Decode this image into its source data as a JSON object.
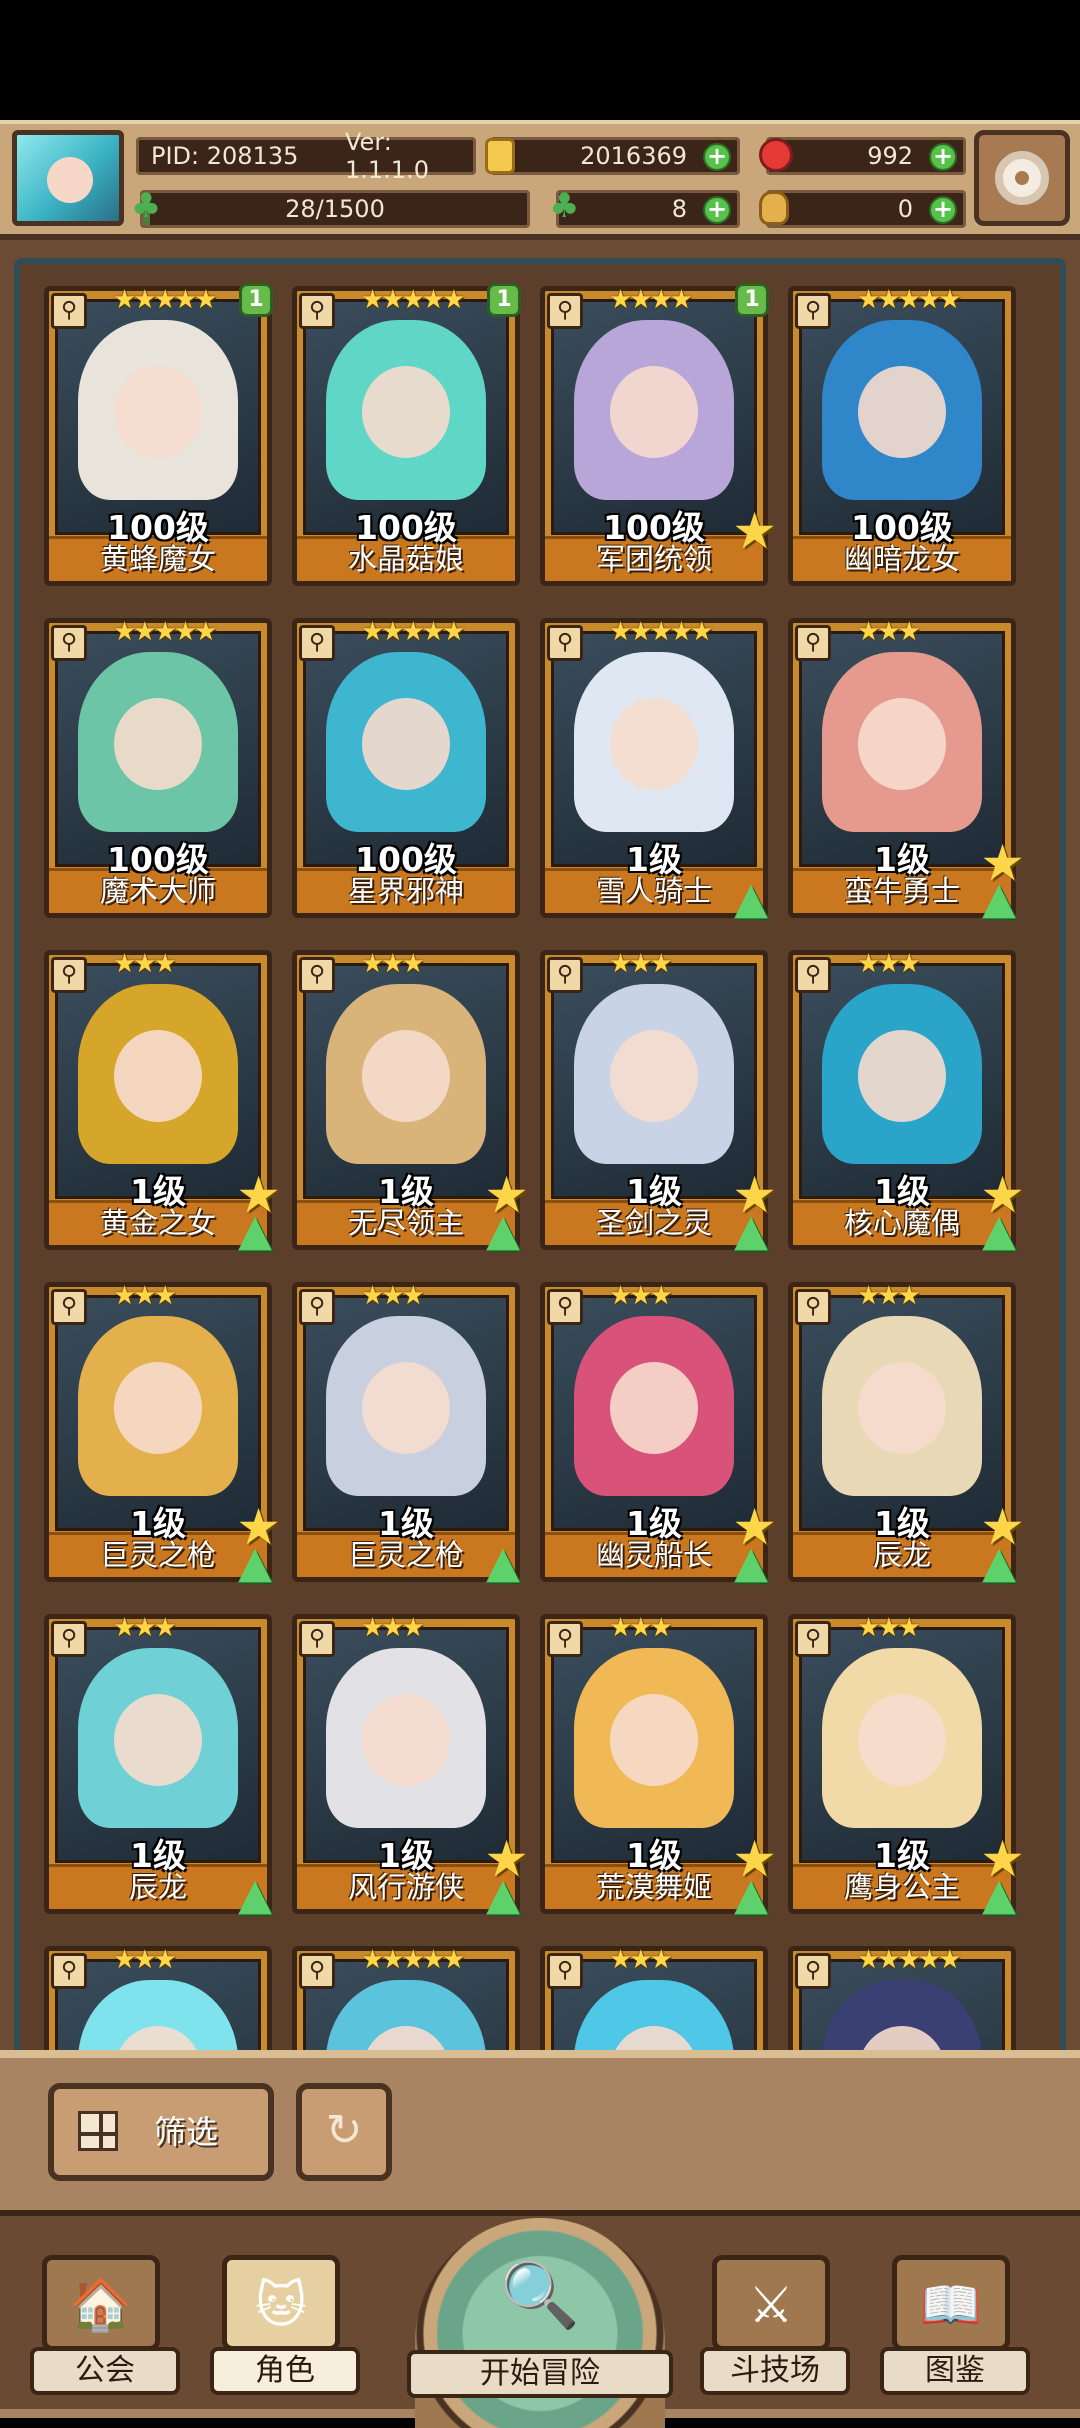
{
  "player": {
    "pid": "PID: 208135",
    "version": "Ver: 1.1.1.0",
    "xp": "28/1500",
    "xp_fraction": 0.0187
  },
  "currencies": {
    "gold": "2016369",
    "gems": "992",
    "clover": "8",
    "bag": "0"
  },
  "heroes": [
    {
      "name": "黄蜂魔女",
      "level": "100级",
      "stars": "★★★★★",
      "badge": "1",
      "fav": false,
      "upgrade": false,
      "color": "#e8e4dc"
    },
    {
      "name": "水晶菇娘",
      "level": "100级",
      "stars": "★★★★★",
      "badge": "1",
      "fav": false,
      "upgrade": false,
      "color": "#5fd6c6"
    },
    {
      "name": "军团统领",
      "level": "100级",
      "stars": "★★★★",
      "badge": "1",
      "fav": true,
      "upgrade": false,
      "color": "#b8a6d9"
    },
    {
      "name": "幽暗龙女",
      "level": "100级",
      "stars": "★★★★★",
      "badge": "",
      "fav": false,
      "upgrade": false,
      "color": "#2f86c9"
    },
    {
      "name": "魔术大师",
      "level": "100级",
      "stars": "★★★★★",
      "badge": "",
      "fav": false,
      "upgrade": false,
      "color": "#6cc5a7"
    },
    {
      "name": "星界邪神",
      "level": "100级",
      "stars": "★★★★★",
      "badge": "",
      "fav": false,
      "upgrade": false,
      "color": "#3fb6cf"
    },
    {
      "name": "雪人骑士",
      "level": "1级",
      "stars": "★★★★★",
      "badge": "",
      "fav": false,
      "upgrade": true,
      "color": "#dfe8f2"
    },
    {
      "name": "蛮牛勇士",
      "level": "1级",
      "stars": "★★★",
      "badge": "",
      "fav": true,
      "upgrade": true,
      "color": "#e69a8d"
    },
    {
      "name": "黄金之女",
      "level": "1级",
      "stars": "★★★",
      "badge": "",
      "fav": true,
      "upgrade": true,
      "color": "#d6a62a"
    },
    {
      "name": "无尽领主",
      "level": "1级",
      "stars": "★★★",
      "badge": "",
      "fav": true,
      "upgrade": true,
      "color": "#d8b47a"
    },
    {
      "name": "圣剑之灵",
      "level": "1级",
      "stars": "★★★",
      "badge": "",
      "fav": true,
      "upgrade": true,
      "color": "#c9d3e6"
    },
    {
      "name": "核心魔偶",
      "level": "1级",
      "stars": "★★★",
      "badge": "",
      "fav": true,
      "upgrade": true,
      "color": "#2aa4c9"
    },
    {
      "name": "巨灵之枪",
      "level": "1级",
      "stars": "★★★",
      "badge": "",
      "fav": true,
      "upgrade": true,
      "color": "#e3b04b"
    },
    {
      "name": "巨灵之枪",
      "level": "1级",
      "stars": "★★★",
      "badge": "",
      "fav": false,
      "upgrade": true,
      "color": "#c8d0e0"
    },
    {
      "name": "幽灵船长",
      "level": "1级",
      "stars": "★★★",
      "badge": "",
      "fav": true,
      "upgrade": true,
      "color": "#d9527a"
    },
    {
      "name": "辰龙",
      "level": "1级",
      "stars": "★★★",
      "badge": "",
      "fav": true,
      "upgrade": true,
      "color": "#e9d8b6"
    },
    {
      "name": "辰龙",
      "level": "1级",
      "stars": "★★★",
      "badge": "",
      "fav": false,
      "upgrade": true,
      "color": "#6fd0d6"
    },
    {
      "name": "风行游侠",
      "level": "1级",
      "stars": "★★★",
      "badge": "",
      "fav": true,
      "upgrade": true,
      "color": "#e2e2e6"
    },
    {
      "name": "荒漠舞姬",
      "level": "1级",
      "stars": "★★★",
      "badge": "",
      "fav": true,
      "upgrade": true,
      "color": "#f0b955"
    },
    {
      "name": "鹰身公主",
      "level": "1级",
      "stars": "★★★",
      "badge": "",
      "fav": true,
      "upgrade": true,
      "color": "#f1d9a8"
    },
    {
      "name": "",
      "level": "",
      "stars": "★★★",
      "badge": "",
      "fav": false,
      "upgrade": false,
      "color": "#7fe3ee"
    },
    {
      "name": "",
      "level": "",
      "stars": "★★★★★",
      "badge": "",
      "fav": false,
      "upgrade": false,
      "color": "#5cc3dd"
    },
    {
      "name": "",
      "level": "",
      "stars": "★★★",
      "badge": "",
      "fav": false,
      "upgrade": false,
      "color": "#4fc7e6"
    },
    {
      "name": "",
      "level": "",
      "stars": "★★★★★",
      "badge": "",
      "fav": false,
      "upgrade": false,
      "color": "#3a3f74"
    }
  ],
  "controls": {
    "filter_label": "筛选",
    "refresh_icon": "refresh-icon"
  },
  "nav": {
    "guild": "公会",
    "character": "角色",
    "adventure": "开始冒险",
    "arena": "斗技场",
    "codex": "图鉴"
  }
}
